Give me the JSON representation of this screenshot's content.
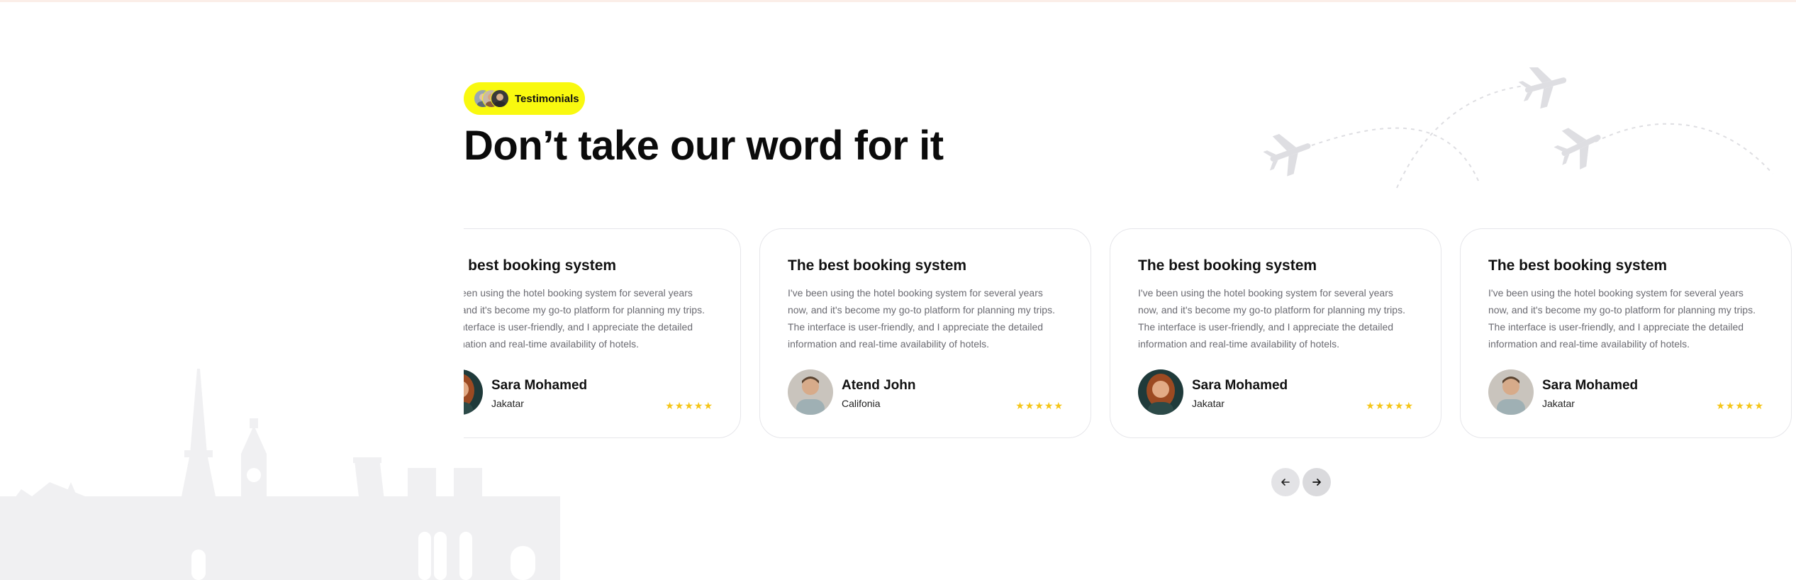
{
  "section": {
    "badge_label": "Testimonials",
    "title": "Don’t take our word for it"
  },
  "testimonials": [
    {
      "title": "The best booking system",
      "text": "I've been using the hotel booking system for several years now, and it's become my go-to platform for planning my trips. The interface is user-friendly, and I appreciate the detailed information and real-time availability of hotels.",
      "name": "Sara Mohamed",
      "location": "Jakatar",
      "rating": 5,
      "stars": "★★★★★"
    },
    {
      "title": "The best booking system",
      "text": "I've been using the hotel booking system for several years now, and it's become my go-to platform for planning my trips. The interface is user-friendly, and I appreciate the detailed information and real-time availability of hotels.",
      "name": "Atend John",
      "location": "Califonia",
      "rating": 5,
      "stars": "★★★★★"
    },
    {
      "title": "The best booking system",
      "text": "I've been using the hotel booking system for several years now, and it's become my go-to platform for planning my trips. The interface is user-friendly, and I appreciate the detailed information and real-time availability of hotels.",
      "name": "Sara Mohamed",
      "location": "Jakatar",
      "rating": 5,
      "stars": "★★★★★"
    },
    {
      "title": "The best booking system",
      "text": "I've been using the hotel booking system for several years now, and it's become my go-to platform for planning my trips. The interface is user-friendly, and I appreciate the detailed information and real-time availability of hotels.",
      "name": "Sara Mohamed",
      "location": "Jakatar",
      "rating": 5,
      "stars": "★★★★★"
    }
  ],
  "navigation": {
    "prev_icon": "arrow-left-icon",
    "next_icon": "arrow-right-icon"
  },
  "colors": {
    "badge_background": "#f9f90f",
    "star": "#f5c518",
    "card_border": "#e6e6ea",
    "decoration": "#ececef"
  }
}
